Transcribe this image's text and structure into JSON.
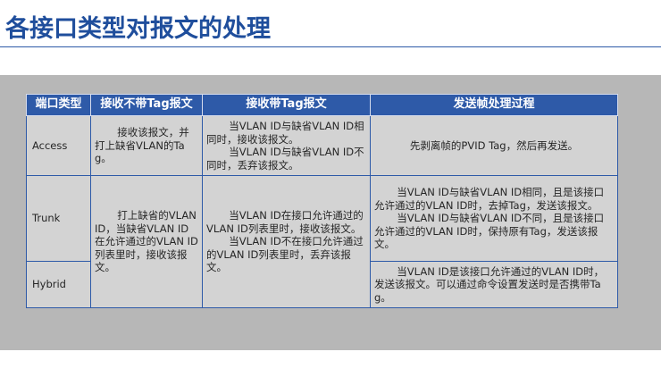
{
  "title": "各接口类型对报文的处理",
  "table": {
    "headers": [
      "端口类型",
      "接收不带Tag报文",
      "接收带Tag报文",
      "发送帧处理过程"
    ],
    "rows": [
      {
        "type": "Access",
        "untagged": "接收该报文，并打上缺省VLAN的Tag。",
        "tagged_1": "当VLAN ID与缺省VLAN ID相同时，接收该报文。",
        "tagged_2": "当VLAN ID与缺省VLAN ID不同时，丢弃该报文。",
        "send_1": "先剥离帧的PVID Tag，然后再发送。"
      },
      {
        "type": "Trunk",
        "untagged": "打上缺省的VLAN ID，当缺省VLAN ID在允许通过的VLAN ID列表里时，接收该报文。",
        "tagged_1": "当VLAN ID在接口允许通过的VLAN ID列表里时，接收该报文。",
        "tagged_2": "当VLAN ID不在接口允许通过的VLAN ID列表里时，丢弃该报文。",
        "send_1": "当VLAN ID与缺省VLAN ID相同，且是该接口允许通过的VLAN ID时，去掉Tag，发送该报文。",
        "send_2": "当VLAN ID与缺省VLAN ID不同，且是该接口允许通过的VLAN ID时，保持原有Tag，发送该报文。"
      },
      {
        "type": "Hybrid",
        "send_1": "当VLAN ID是该接口允许通过的VLAN ID时，发送该报文。可以通过命令设置发送时是否携带Tag。"
      }
    ]
  }
}
